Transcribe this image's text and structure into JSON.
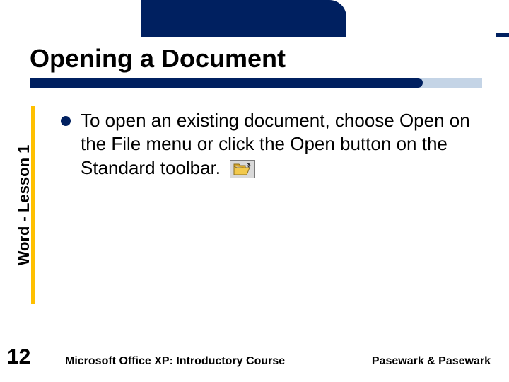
{
  "slide": {
    "title": "Opening a Document",
    "side_label": "Word - Lesson 1",
    "page_number": "12",
    "bullet_text": "To open an existing document, choose Open on the File menu or click the Open button on the Standard toolbar.",
    "footer_left": "Microsoft Office XP:  Introductory Course",
    "footer_right": "Pasewark & Pasewark"
  },
  "icons": {
    "open": "open-folder-icon"
  },
  "colors": {
    "navy": "#002060",
    "gold": "#ffc000",
    "underline_back": "#c4d4e6"
  }
}
